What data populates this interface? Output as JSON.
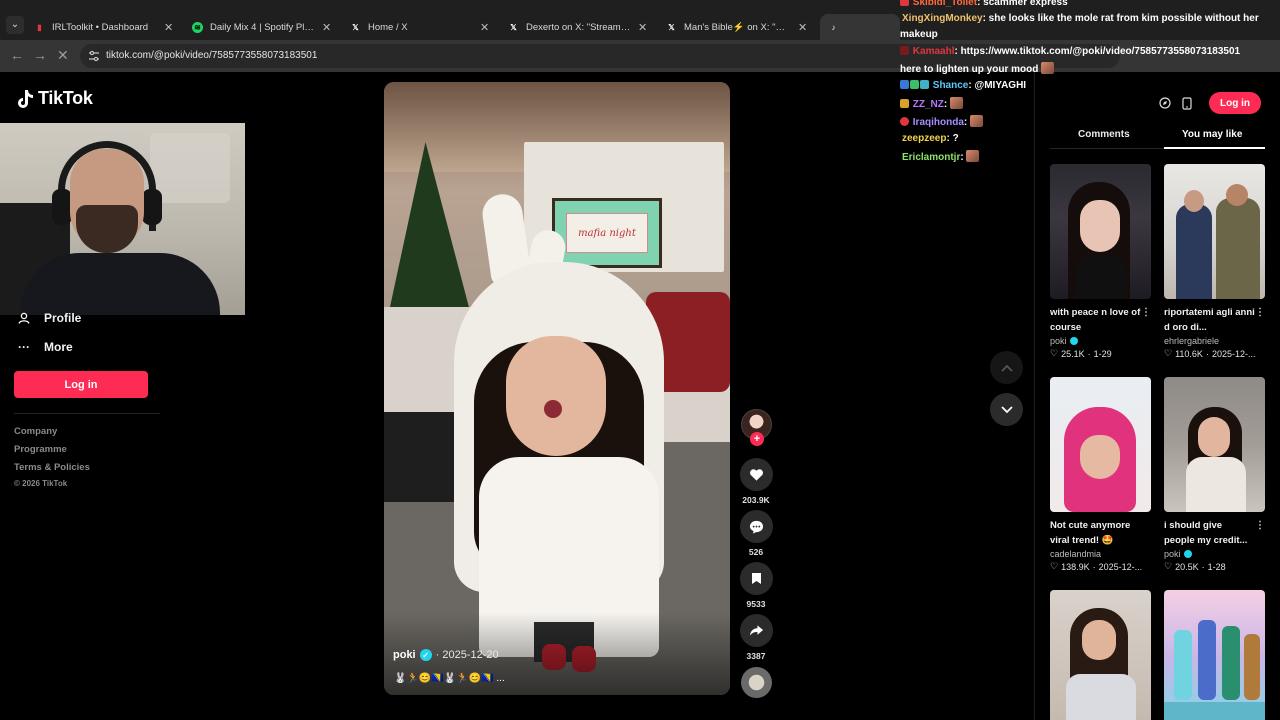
{
  "browser": {
    "tabs": [
      {
        "title": "IRLToolkit • Dashboard",
        "icon": "irltoolkit-favicon",
        "color": "#e0373f"
      },
      {
        "title": "Daily Mix 4 | Spotify Playlist",
        "icon": "spotify-favicon",
        "color": "#1ed760"
      },
      {
        "title": "Home / X",
        "icon": "x-favicon",
        "color": "#ffffff"
      },
      {
        "title": "Dexerto on X: \"Streamers Kyedae",
        "icon": "x-favicon",
        "color": "#ffffff"
      },
      {
        "title": "Man's Bible⚡ on X: \"P*RN add",
        "icon": "x-favicon",
        "color": "#ffffff"
      }
    ],
    "url": "tiktok.com/@poki/video/7585773558073183501"
  },
  "tiktok": {
    "logo_text": "TikTok",
    "sidebar": {
      "profile": "Profile",
      "more": "More",
      "login": "Log in"
    },
    "footer": {
      "company": "Company",
      "programme": "Programme",
      "terms": "Terms & Policies",
      "copyright": "© 2026 TikTok"
    },
    "video": {
      "author": "poki",
      "date": "· 2025-12-20",
      "caption": "🐰🏃😊🇧🇦🐰🏃😊🇧🇦 ...",
      "screen_text": "mafia night"
    },
    "actions": {
      "likes": "203.9K",
      "comments": "526",
      "saves": "9533",
      "shares": "3387"
    },
    "right_panel": {
      "login": "Log in",
      "tab_comments": "Comments",
      "tab_you_may_like": "You may like",
      "cards": [
        {
          "title": "with peace n love of course",
          "author": "poki",
          "verified": true,
          "likes": "25.1K",
          "date": "1-29",
          "overlay": ""
        },
        {
          "title": "riportatemi agli anni d oro di...",
          "author": "ehrlergabriele",
          "verified": false,
          "likes": "110.6K",
          "date": "2025-12-...",
          "overlay": ""
        },
        {
          "title": "Not cute anymore viral trend! 🤩",
          "author": "cadelandmia",
          "verified": false,
          "likes": "138.9K",
          "date": "2025-12-...",
          "overlay": ""
        },
        {
          "title": "i should give people my credit...",
          "author": "poki",
          "verified": true,
          "likes": "20.5K",
          "date": "1-28",
          "overlay": ""
        }
      ]
    }
  },
  "chat": [
    {
      "user": "Skibidi_Toilet",
      "text": ": scammer express",
      "color": "#ff6a3d"
    },
    {
      "user": "XingXingMonkey",
      "text": ": she looks like the mole rat from kim possible without her",
      "color": "#f0c16c"
    },
    {
      "user": "",
      "text": "makeup",
      "color": "#ffffff"
    },
    {
      "user": "Kamaahl",
      "text": ": https://www.tiktok.com/@poki/video/7585773558073183501",
      "color": "#e0373f"
    },
    {
      "user": "",
      "text": "here to lighten up your mood",
      "color": "#ffffff"
    },
    {
      "user": "Shance",
      "text": ": @MIYAGHI",
      "color": "#5ec8ff"
    },
    {
      "user": "ZZ_NZ",
      "text": ":",
      "color": "#b777ff"
    },
    {
      "user": "Iraqihonda",
      "text": ":",
      "color": "#a98cff"
    },
    {
      "user": "zeepzeep",
      "text": ": ?",
      "color": "#f2d44a"
    },
    {
      "user": "Ericlamontjr",
      "text": ":",
      "color": "#8fe36b"
    }
  ]
}
